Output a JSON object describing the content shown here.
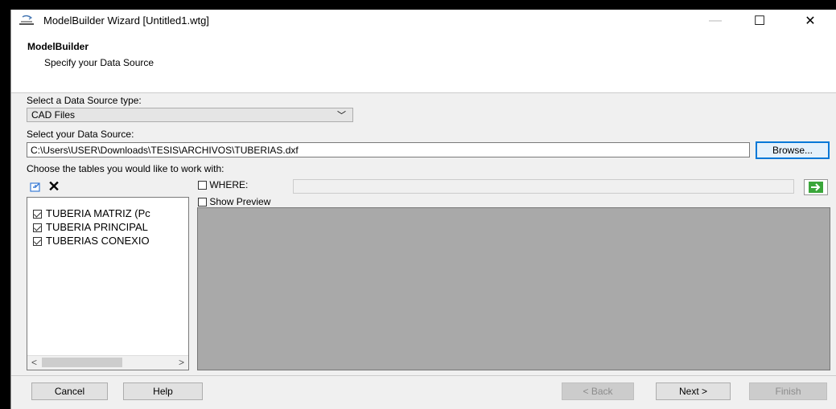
{
  "window": {
    "title": "ModelBuilder Wizard [Untitled1.wtg]",
    "icon": "modelbuilder-app-icon",
    "controls": [
      "minimize-icon",
      "maximize-icon",
      "close-icon"
    ],
    "minimize_glyph": "—",
    "maximize_glyph": "☐",
    "close_glyph": "✕"
  },
  "header": {
    "title": "ModelBuilder",
    "subtitle": "Specify your Data Source"
  },
  "source_type": {
    "label": "Select a Data Source type:",
    "selected": "CAD Files"
  },
  "data_source": {
    "label": "Select your Data Source:",
    "value": "C:\\Users\\USER\\Downloads\\TESIS\\ARCHIVOS\\TUBERIAS.dxf",
    "browse_label": "Browse..."
  },
  "tables": {
    "label": "Choose the tables you would like to work with:",
    "items": [
      {
        "label": "TUBERIA MATRIZ (Pc",
        "checked": true
      },
      {
        "label": "TUBERIA PRINCIPAL",
        "checked": true
      },
      {
        "label": "TUBERIAS CONEXIO",
        "checked": true
      }
    ]
  },
  "filter": {
    "where_label": "WHERE:",
    "where_checked": false,
    "show_preview_label": "Show Preview",
    "show_preview_checked": false
  },
  "buttons": {
    "cancel": "Cancel",
    "help": "Help",
    "back": "< Back",
    "next": "Next >",
    "finish": "Finish"
  },
  "colors": {
    "focus_border": "#0078d7",
    "preview_bg": "#a9a9a9",
    "go_arrow": "#2e9c2e"
  }
}
